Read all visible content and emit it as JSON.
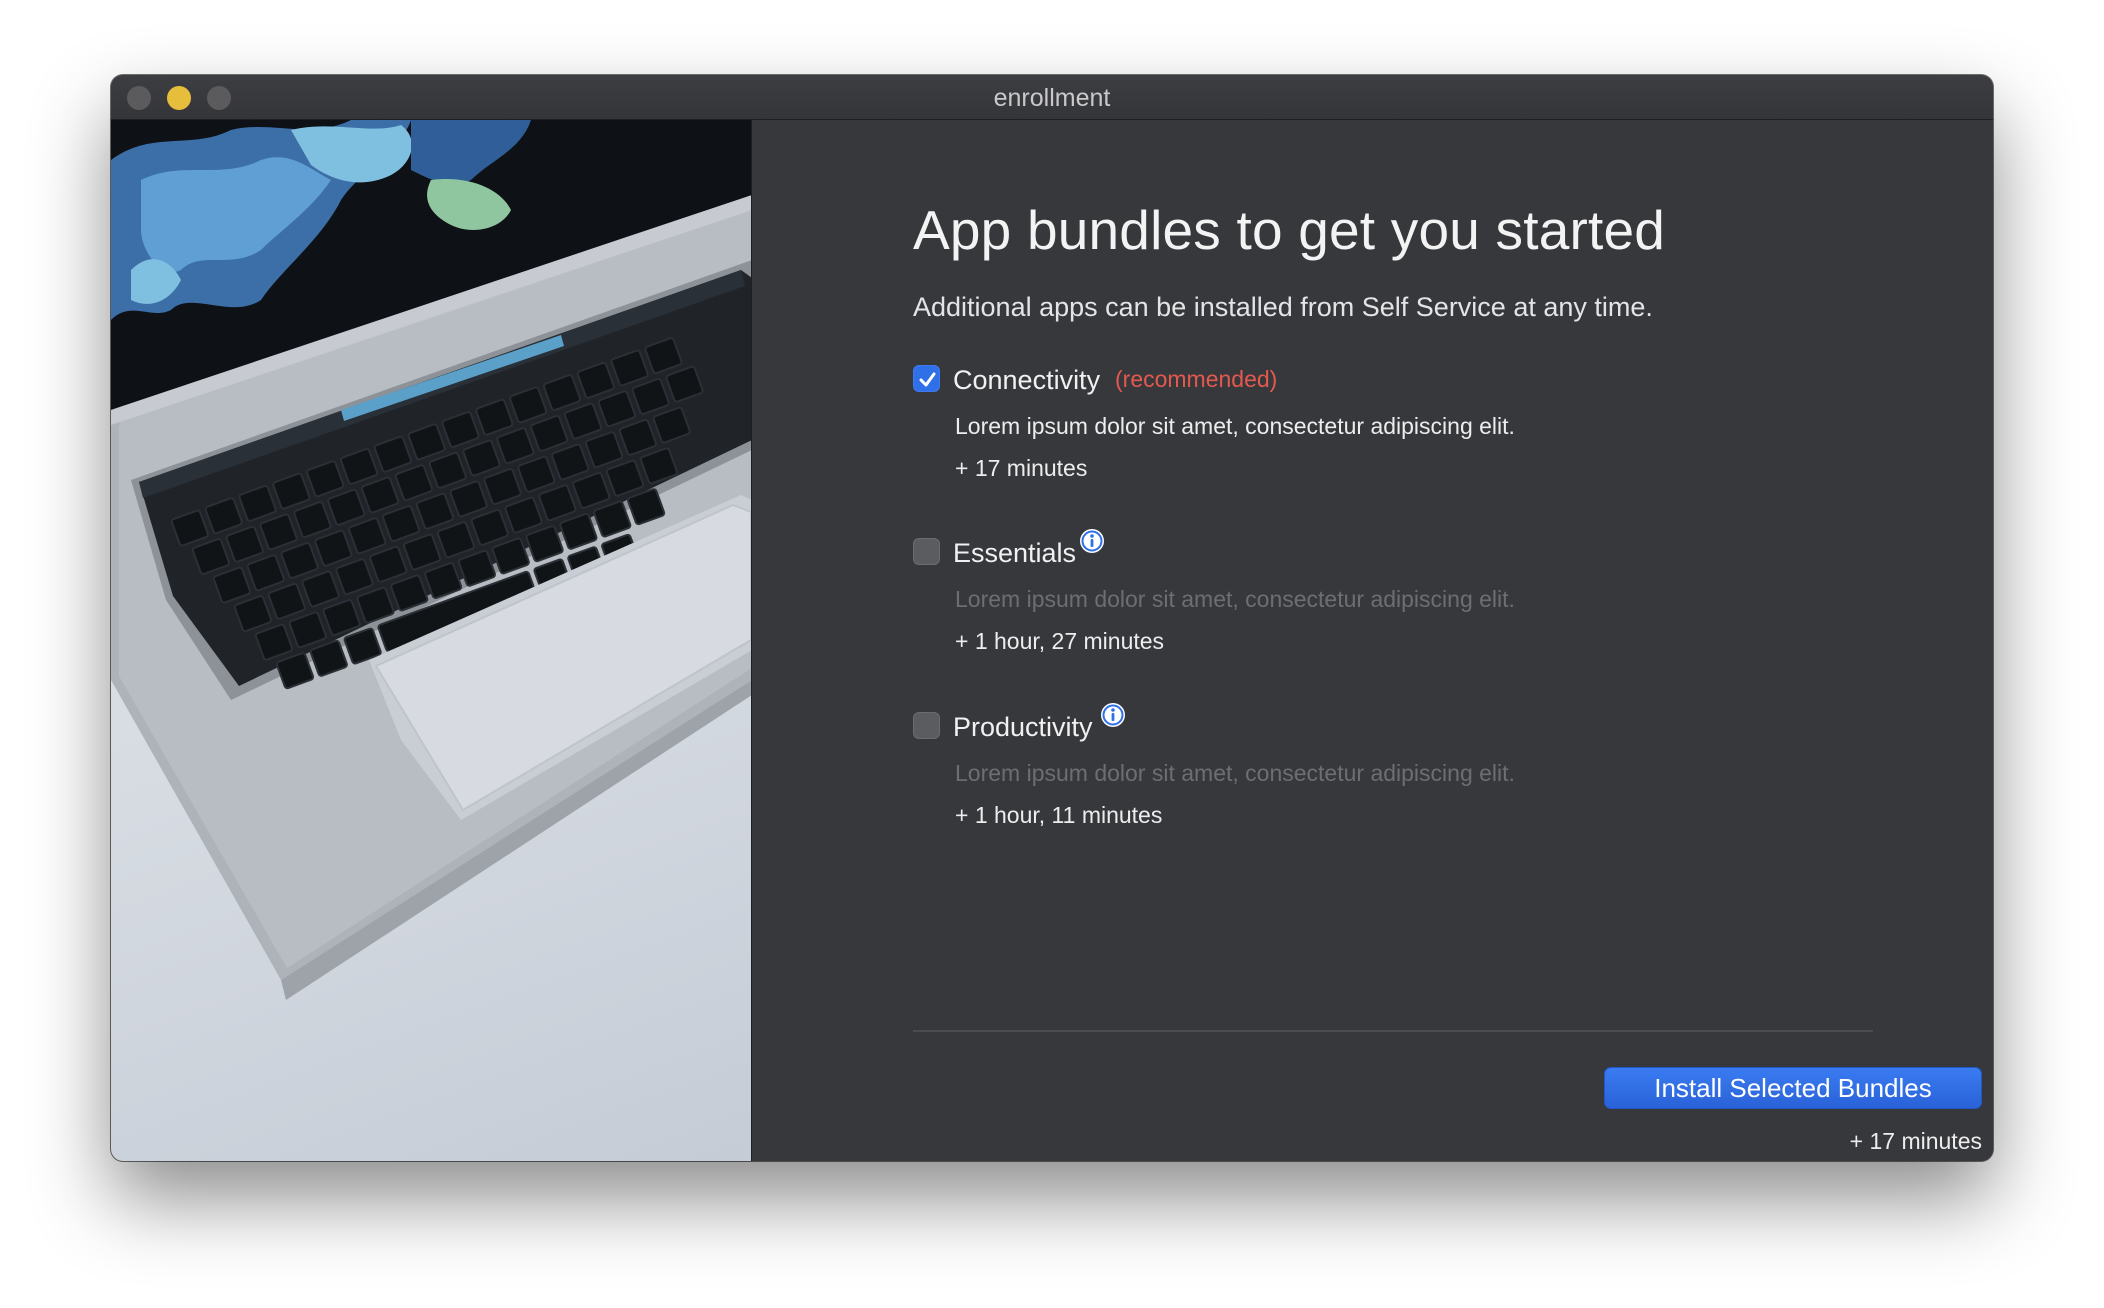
{
  "window": {
    "title": "enrollment"
  },
  "page": {
    "heading": "App bundles to get you started",
    "subheading": "Additional apps can be installed from Self Service at any time."
  },
  "bundles": [
    {
      "name": "Connectivity",
      "checked": true,
      "tag": "(recommended)",
      "description": "Lorem ipsum dolor sit amet, consectetur adipiscing elit.",
      "time": "+ 17 minutes",
      "has_info": false
    },
    {
      "name": "Essentials",
      "checked": false,
      "description": "Lorem ipsum dolor sit amet, consectetur adipiscing elit.",
      "time": "+ 1 hour, 27 minutes",
      "has_info": true
    },
    {
      "name": "Productivity",
      "checked": false,
      "description": "Lorem ipsum dolor sit amet, consectetur adipiscing elit.",
      "time": "+ 1 hour, 11 minutes",
      "has_info": true
    }
  ],
  "footer": {
    "install_label": "Install Selected Bundles",
    "total_time": "+ 17 minutes"
  },
  "icons": {
    "checkmark": "checkmark-icon",
    "info": "info-icon",
    "window_controls": [
      "close-icon",
      "minimize-icon",
      "zoom-icon"
    ]
  },
  "colors": {
    "accent": "#2f6fe8",
    "recommended": "#e4594e",
    "panel_background": "#37383c",
    "muted_text": "#6d6e72"
  }
}
